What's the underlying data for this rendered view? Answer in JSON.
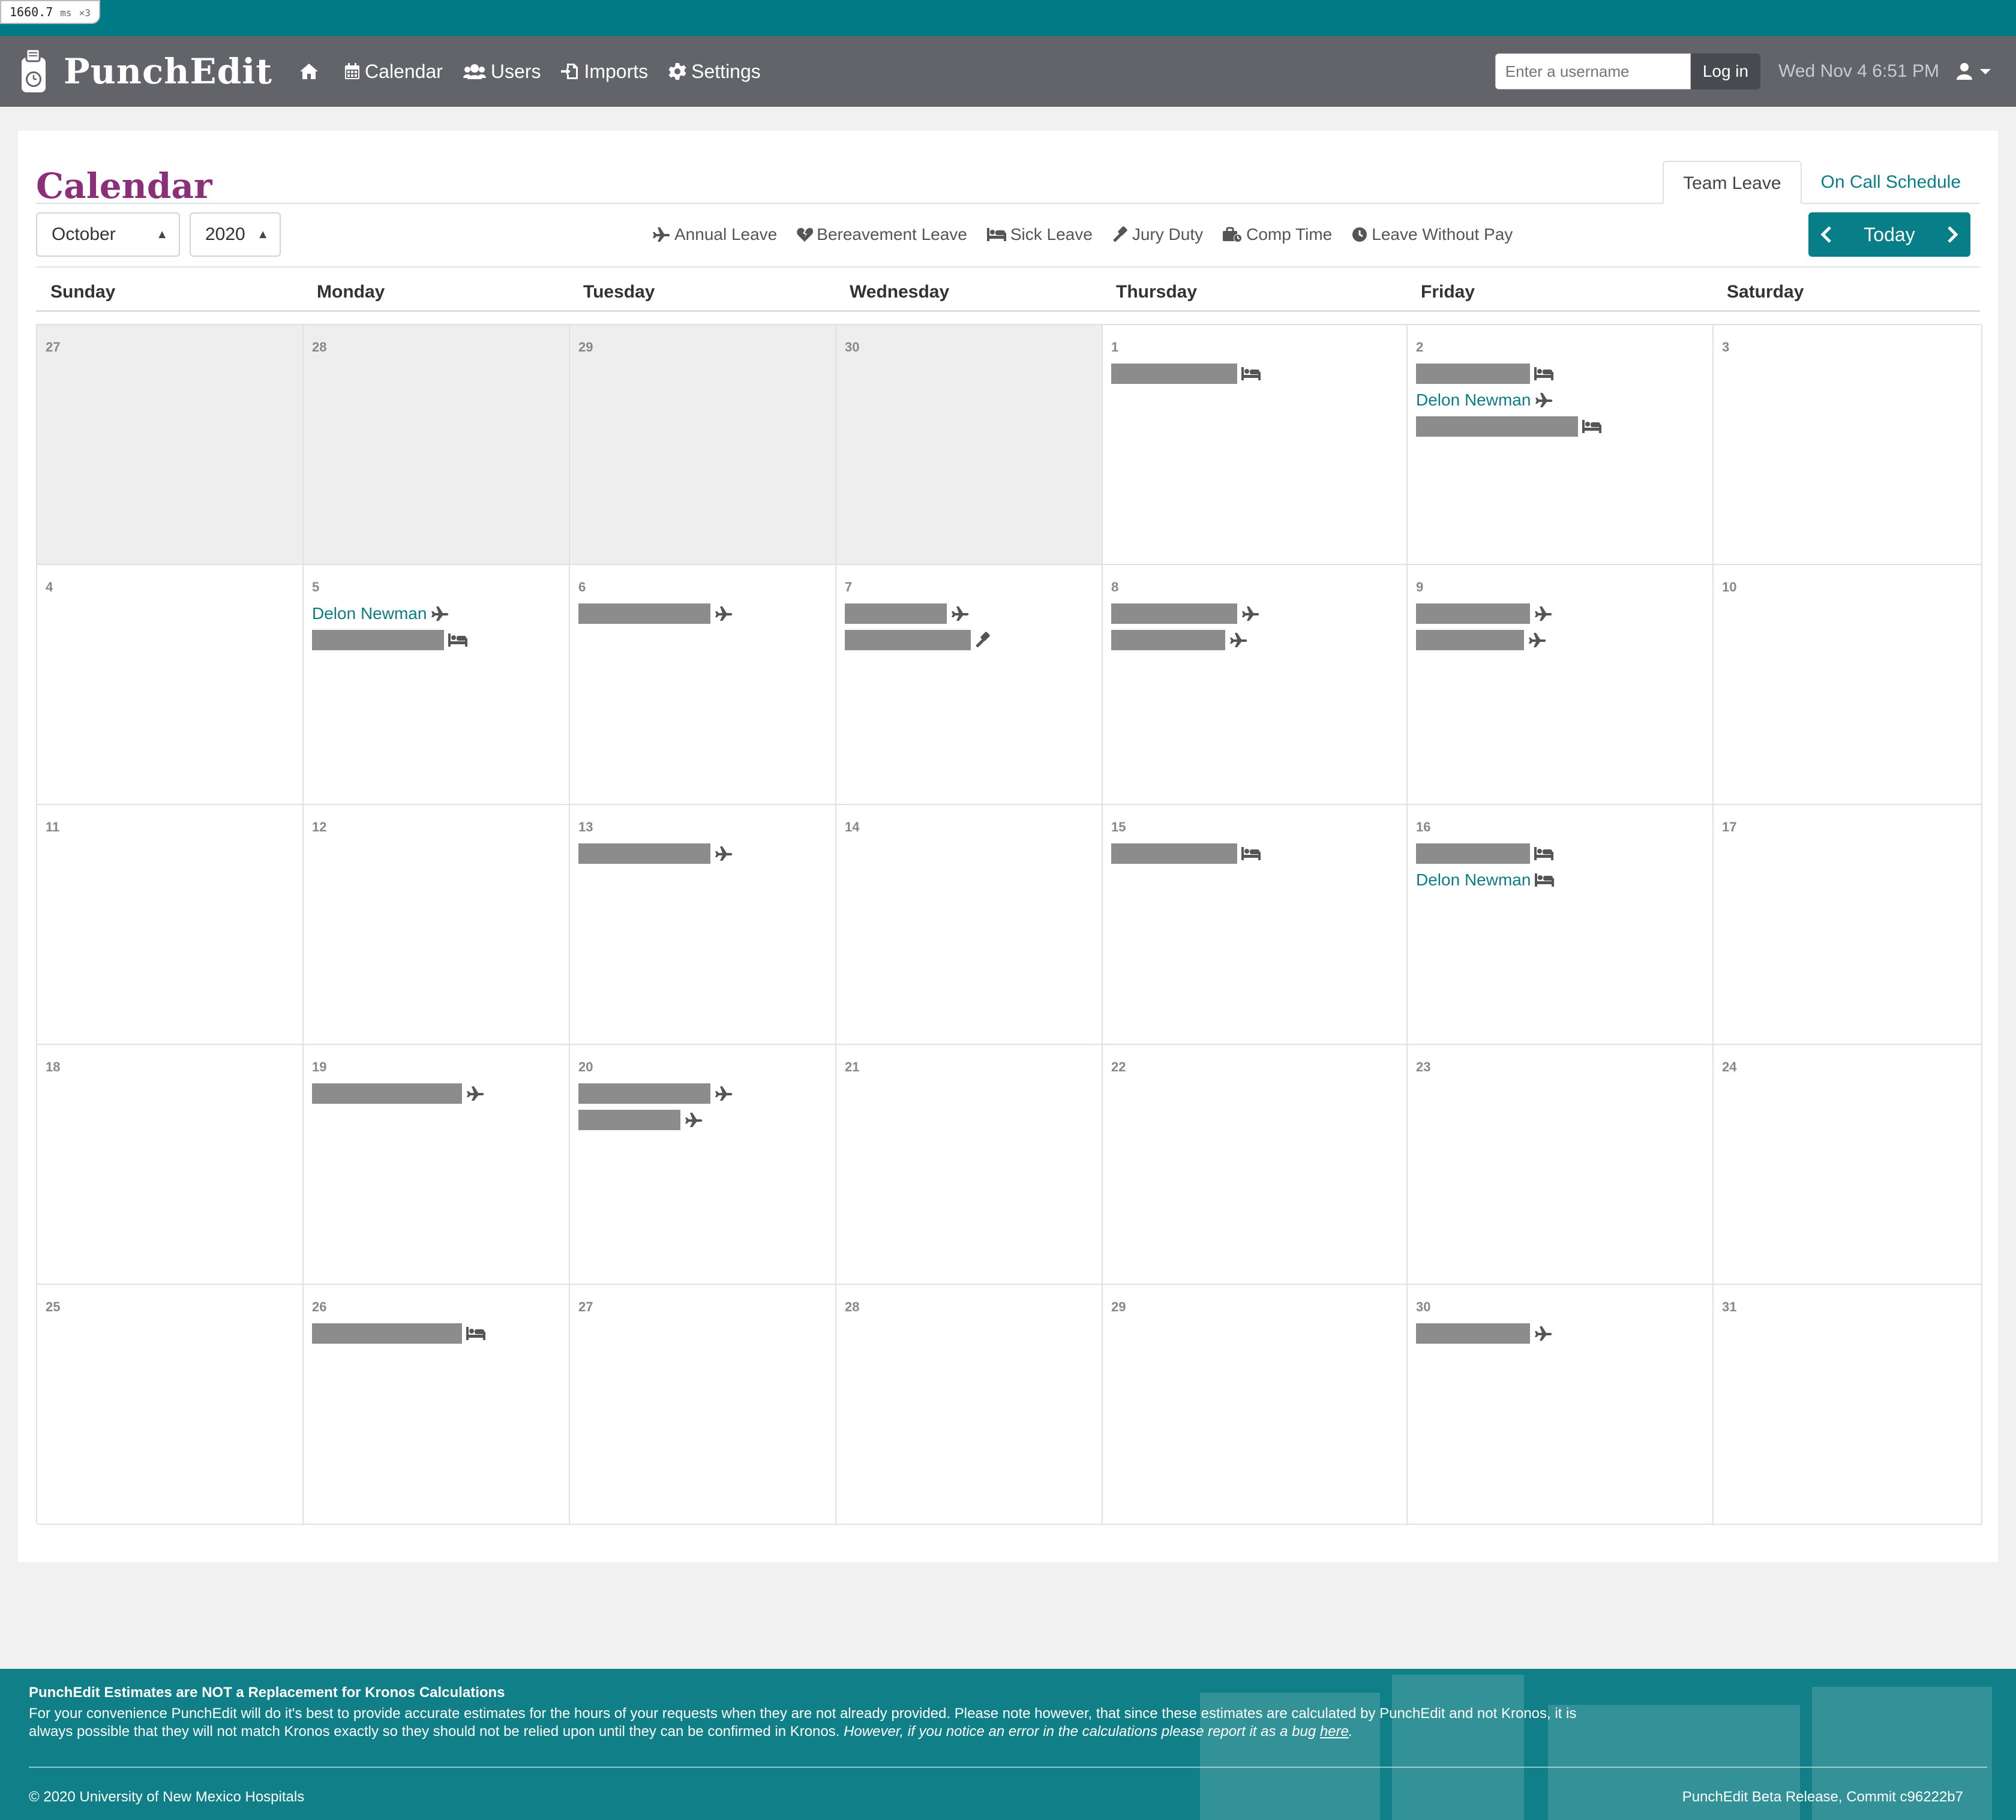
{
  "perf": {
    "value": "1660.7",
    "unit": "ms",
    "multiplier": "×3"
  },
  "brand": {
    "name": "PunchEdit"
  },
  "nav": {
    "home_icon": "home-icon",
    "links": [
      {
        "label": "Calendar",
        "icon": "calendar-icon"
      },
      {
        "label": "Users",
        "icon": "users-icon"
      },
      {
        "label": "Imports",
        "icon": "import-icon"
      },
      {
        "label": "Settings",
        "icon": "gear-icon"
      }
    ]
  },
  "login": {
    "placeholder": "Enter a username",
    "button": "Log in"
  },
  "clock": "Wed Nov 4 6:51 PM",
  "page": {
    "title": "Calendar"
  },
  "tabs": [
    {
      "label": "Team Leave",
      "active": true
    },
    {
      "label": "On Call Schedule",
      "active": false
    }
  ],
  "filters": {
    "month": "October",
    "year": "2020"
  },
  "legend": [
    {
      "label": "Annual Leave",
      "icon": "plane-icon"
    },
    {
      "label": "Bereavement Leave",
      "icon": "broken-heart-icon"
    },
    {
      "label": "Sick Leave",
      "icon": "bed-icon"
    },
    {
      "label": "Jury Duty",
      "icon": "gavel-icon"
    },
    {
      "label": "Comp Time",
      "icon": "comp-time-icon"
    },
    {
      "label": "Leave Without Pay",
      "icon": "clock-icon"
    }
  ],
  "calendar_nav": {
    "today": "Today"
  },
  "weekdays": [
    "Sunday",
    "Monday",
    "Tuesday",
    "Wednesday",
    "Thursday",
    "Friday",
    "Saturday"
  ],
  "weeks": [
    [
      {
        "day": "27",
        "other": true,
        "events": []
      },
      {
        "day": "28",
        "other": true,
        "events": []
      },
      {
        "day": "29",
        "other": true,
        "events": []
      },
      {
        "day": "30",
        "other": true,
        "events": []
      },
      {
        "day": "1",
        "events": [
          {
            "name": "",
            "type": "sick"
          }
        ]
      },
      {
        "day": "2",
        "events": [
          {
            "name": "",
            "type": "sick"
          },
          {
            "name": "Delon Newman",
            "type": "annual"
          },
          {
            "name": "",
            "type": "sick"
          }
        ]
      },
      {
        "day": "3",
        "events": []
      }
    ],
    [
      {
        "day": "4",
        "events": []
      },
      {
        "day": "5",
        "events": [
          {
            "name": "Delon Newman",
            "type": "annual"
          },
          {
            "name": "",
            "type": "sick"
          }
        ]
      },
      {
        "day": "6",
        "events": [
          {
            "name": "",
            "type": "annual"
          }
        ]
      },
      {
        "day": "7",
        "events": [
          {
            "name": "",
            "type": "annual"
          },
          {
            "name": "",
            "type": "jury"
          }
        ]
      },
      {
        "day": "8",
        "events": [
          {
            "name": "",
            "type": "annual"
          },
          {
            "name": "",
            "type": "annual"
          }
        ]
      },
      {
        "day": "9",
        "events": [
          {
            "name": "",
            "type": "annual"
          },
          {
            "name": "",
            "type": "annual"
          }
        ]
      },
      {
        "day": "10",
        "events": []
      }
    ],
    [
      {
        "day": "11",
        "events": []
      },
      {
        "day": "12",
        "events": []
      },
      {
        "day": "13",
        "events": [
          {
            "name": "",
            "type": "annual"
          }
        ]
      },
      {
        "day": "14",
        "events": []
      },
      {
        "day": "15",
        "events": [
          {
            "name": "",
            "type": "sick"
          }
        ]
      },
      {
        "day": "16",
        "events": [
          {
            "name": "",
            "type": "sick"
          },
          {
            "name": "Delon Newman",
            "type": "sick"
          }
        ]
      },
      {
        "day": "17",
        "events": []
      }
    ],
    [
      {
        "day": "18",
        "events": []
      },
      {
        "day": "19",
        "events": [
          {
            "name": "",
            "type": "annual"
          }
        ]
      },
      {
        "day": "20",
        "events": [
          {
            "name": "",
            "type": "annual"
          },
          {
            "name": "",
            "type": "annual"
          }
        ]
      },
      {
        "day": "21",
        "events": []
      },
      {
        "day": "22",
        "events": []
      },
      {
        "day": "23",
        "events": []
      },
      {
        "day": "24",
        "events": []
      }
    ],
    [
      {
        "day": "25",
        "events": []
      },
      {
        "day": "26",
        "events": [
          {
            "name": "",
            "type": "sick"
          }
        ]
      },
      {
        "day": "27",
        "events": []
      },
      {
        "day": "28",
        "events": []
      },
      {
        "day": "29",
        "events": []
      },
      {
        "day": "30",
        "events": [
          {
            "name": "",
            "type": "annual"
          }
        ]
      },
      {
        "day": "31",
        "events": []
      }
    ]
  ],
  "footer": {
    "title": "PunchEdit Estimates are NOT a Replacement for Kronos Calculations",
    "text": "For your convenience PunchEdit will do it's best to provide accurate estimates for the hours of your requests when they are not already provided. Please note however, that since these estimates are calculated by PunchEdit and not Kronos, it is always possible that they will not match Kronos exactly so they should not be relied upon until they can be confirmed in Kronos.",
    "italic": "However, if you notice an error in the calculations please report it as a bug",
    "link": "here",
    "copyright": "© 2020 University of New Mexico Hospitals",
    "release": "PunchEdit Beta Release, Commit c96222b7"
  }
}
